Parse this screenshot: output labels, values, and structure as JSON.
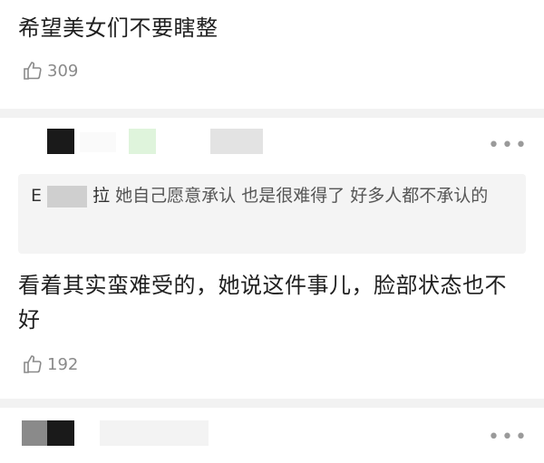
{
  "comments": [
    {
      "text": "希望美女们不要瞎整",
      "likes": "309"
    },
    {
      "quote_name": "E",
      "quote_suffix": "拉",
      "quote_text": "她自己愿意承认 也是很难得了 好多人都不承认的",
      "text": "看着其实蛮难受的，她说这件事儿，脸部状态也不好",
      "likes": "192"
    }
  ],
  "more_label": "•••",
  "icons": {
    "like": "thumbs-up-icon",
    "more": "more-dots-icon"
  },
  "colors": {
    "divider": "#f2f2f2",
    "quote_bg": "#f4f4f4",
    "muted": "#8a8a8a"
  }
}
